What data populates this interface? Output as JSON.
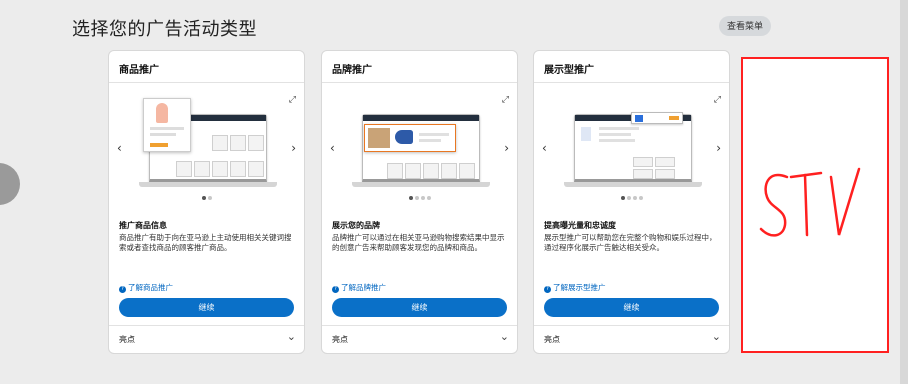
{
  "page": {
    "title": "选择您的广告活动类型",
    "compare_label": "查看菜单"
  },
  "cards": [
    {
      "title": "商品推广",
      "subtitle": "推广商品信息",
      "description": "商品推广有助于向在亚马逊上主动使用相关关键词搜索或者查找商品的顾客推广商品。",
      "learn_more": "了解商品推广",
      "button": "继续",
      "highlights": "亮点",
      "dots_total": 2,
      "dots_active": 0
    },
    {
      "title": "品牌推广",
      "subtitle": "展示您的品牌",
      "description": "品牌推广可以通过在相关亚马逊购物搜索结果中显示的创意广告来帮助顾客发现您的品牌和商品。",
      "learn_more": "了解品牌推广",
      "button": "继续",
      "highlights": "亮点",
      "dots_total": 4,
      "dots_active": 0
    },
    {
      "title": "展示型推广",
      "subtitle": "提高曝光量和忠诚度",
      "description": "展示型推广可以帮助您在完整个购物和娱乐过程中，通过程序化展示广告触达相关受众。",
      "learn_more": "了解展示型推广",
      "button": "继续",
      "highlights": "亮点",
      "dots_total": 4,
      "dots_active": 0
    }
  ],
  "annotation": {
    "text": "STV",
    "color": "#ff2020"
  },
  "colors": {
    "accent": "#0a70c8",
    "link": "#0066c0",
    "background": "#ececec"
  }
}
